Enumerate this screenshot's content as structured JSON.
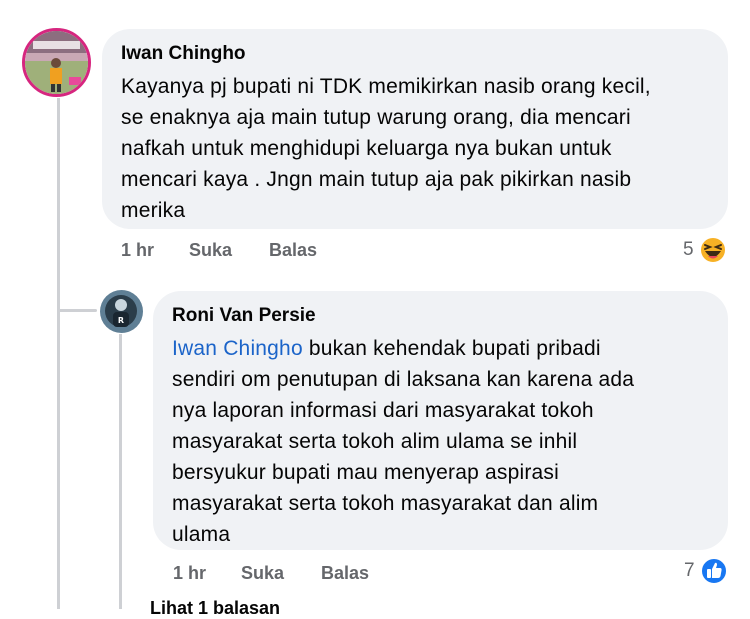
{
  "comments": [
    {
      "author": "Iwan Chingho",
      "avatar_icon": "profile-photo-icon",
      "text_lines": [
        "Kayanya pj bupati ni TDK memikirkan nasib orang kecil,",
        "se enaknya aja main tutup warung orang, dia mencari",
        "nafkah untuk menghidupi keluarga nya bukan untuk",
        "mencari kaya . Jngn main tutup aja pak  pikirkan nasib",
        "merika"
      ],
      "time": "1 hr",
      "like_label": "Suka",
      "reply_label": "Balas",
      "reaction_count": "5",
      "reaction_icon": "haha-emoji-icon"
    },
    {
      "author": "Roni Van Persie",
      "avatar_icon": "profile-photo-icon",
      "mention": "Iwan Chingho",
      "first_line_rest": " bukan kehendak bupati pribadi",
      "text_lines": [
        "sendiri om penutupan di laksana kan karena ada",
        "nya laporan informasi dari masyarakat tokoh",
        "masyarakat serta tokoh alim ulama se inhil",
        "bersyukur bupati mau menyerap aspirasi",
        "masyarakat serta tokoh masyarakat dan alim",
        "ulama"
      ],
      "time": "1 hr",
      "like_label": "Suka",
      "reply_label": "Balas",
      "reaction_count": "7",
      "reaction_icon": "like-thumb-icon"
    }
  ],
  "see_more_replies": "Lihat 1 balasan",
  "colors": {
    "bubble": "#f0f2f5",
    "meta_text": "#65676b",
    "mention": "#1b64c9",
    "like_blue": "#1877f2",
    "haha_yellow": "#f7b125",
    "thread_line": "#ced0d4"
  }
}
